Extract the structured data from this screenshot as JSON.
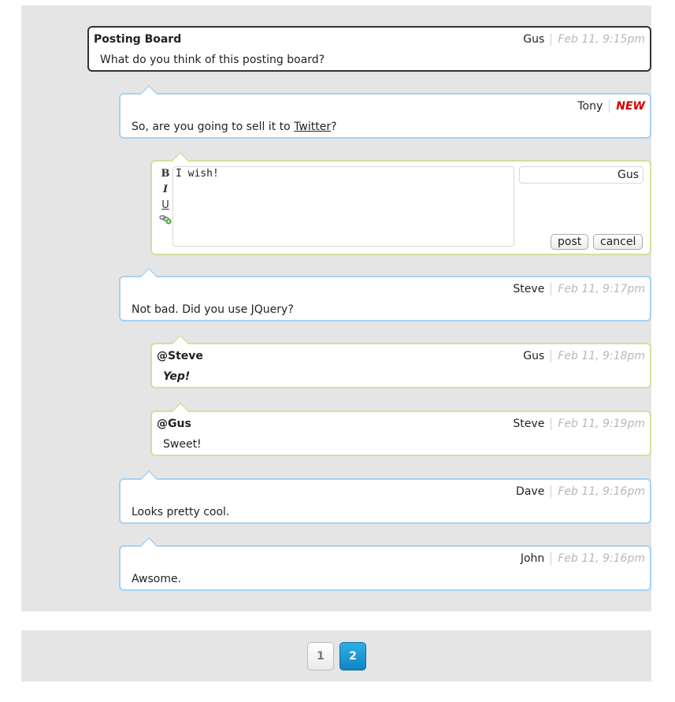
{
  "root": {
    "title": "Posting Board",
    "author": "Gus",
    "date": "Feb 11, 9:15pm",
    "text": "What do you think of this posting board?"
  },
  "tony": {
    "author": "Tony",
    "badge": "NEW",
    "text_before": "So, are you going to sell it to ",
    "link": "Twitter",
    "text_after": "?"
  },
  "editor": {
    "tools": [
      "B",
      "I",
      "U",
      "link-add"
    ],
    "text": "I wish!",
    "name": "Gus",
    "post_label": "post",
    "cancel_label": "cancel"
  },
  "steve1": {
    "author": "Steve",
    "date": "Feb 11, 9:17pm",
    "text": "Not bad. Did you use JQuery?"
  },
  "gus_reply": {
    "title": "@Steve",
    "author": "Gus",
    "date": "Feb 11, 9:18pm",
    "text": "Yep!"
  },
  "steve_reply": {
    "title": "@Gus",
    "author": "Steve",
    "date": "Feb 11, 9:19pm",
    "text": "Sweet!"
  },
  "dave": {
    "author": "Dave",
    "date": "Feb 11, 9:16pm",
    "text": "Looks pretty cool."
  },
  "john": {
    "author": "John",
    "date": "Feb 11, 9:16pm",
    "text": "Awsome."
  },
  "pagination": {
    "pages": [
      "1",
      "2"
    ],
    "current": "2"
  },
  "colors": {
    "blue_border": "#a6d2f2",
    "green_border": "#cfe19a",
    "new_badge": "#d40000",
    "active_page": "#1a9ad6"
  }
}
